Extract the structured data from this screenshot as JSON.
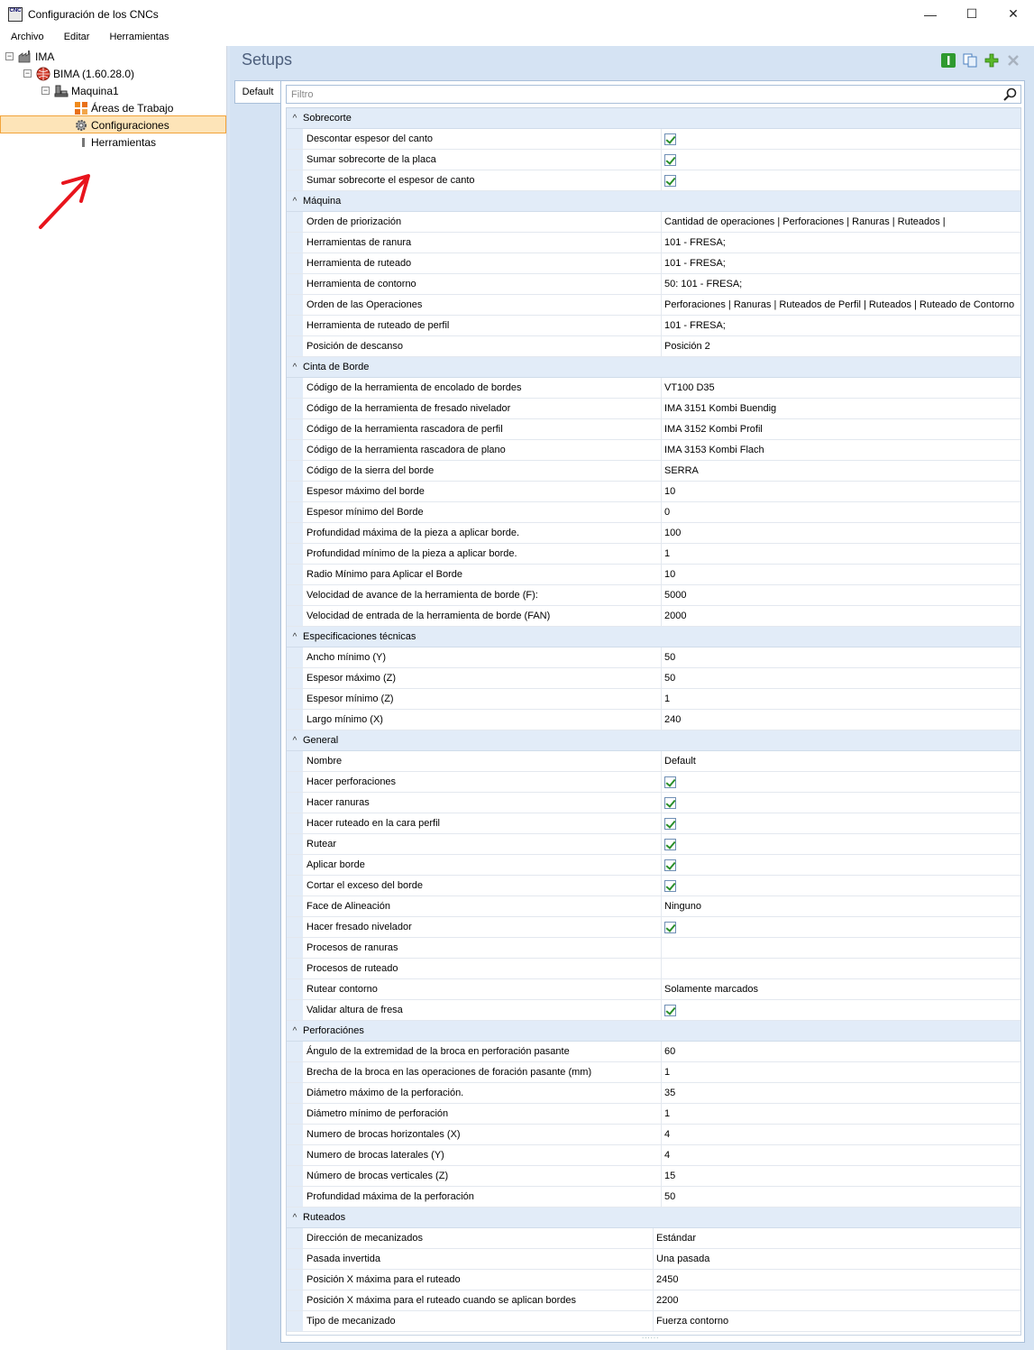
{
  "window": {
    "title": "Configuración de los CNCs",
    "icon_text": "CNC",
    "controls": [
      "—",
      "☐",
      "✕"
    ]
  },
  "menu": [
    "Archivo",
    "Editar",
    "Herramientas"
  ],
  "tree": [
    {
      "label": "IMA",
      "level": 0,
      "expander": "−",
      "icon": "factory-icon"
    },
    {
      "label": "BIMA (1.60.28.0)",
      "level": 1,
      "expander": "−",
      "icon": "globe-icon"
    },
    {
      "label": "Maquina1",
      "level": 2,
      "expander": "−",
      "icon": "machine-icon"
    },
    {
      "label": "Áreas de Trabajo",
      "level": 3,
      "icon": "grid-icon"
    },
    {
      "label": "Configuraciones",
      "level": 3,
      "icon": "gear-icon",
      "selected": true
    },
    {
      "label": "Herramientas",
      "level": 3,
      "icon": "tools-icon"
    }
  ],
  "panel": {
    "title": "Setups",
    "tab": "Default",
    "filter_placeholder": "Filtro"
  },
  "categories": [
    {
      "name": "Sobrecorte",
      "rows": [
        {
          "name": "Descontar espesor del canto",
          "check": true
        },
        {
          "name": "Sumar sobrecorte de la placa",
          "check": true
        },
        {
          "name": "Sumar sobrecorte el espesor de canto",
          "check": true
        }
      ]
    },
    {
      "name": "Máquina",
      "rows": [
        {
          "name": "Orden de priorización",
          "value": "Cantidad de operaciones | Perforaciones | Ranuras | Ruteados |"
        },
        {
          "name": "Herramientas de ranura",
          "value": "101 - FRESA;"
        },
        {
          "name": "Herramienta de ruteado",
          "value": "101 - FRESA;"
        },
        {
          "name": "Herramienta de contorno",
          "value": "50: 101 - FRESA;"
        },
        {
          "name": "Orden de las Operaciones",
          "value": "Perforaciones | Ranuras | Ruteados de Perfil | Ruteados | Ruteado de Contorno"
        },
        {
          "name": "Herramienta de ruteado de perfil",
          "value": "101 - FRESA;"
        },
        {
          "name": "Posición de descanso",
          "value": "Posición 2"
        }
      ]
    },
    {
      "name": "Cinta de Borde",
      "rows": [
        {
          "name": "Código de la herramienta de encolado de bordes",
          "value": "VT100 D35"
        },
        {
          "name": "Código de la herramienta de fresado nivelador",
          "value": "IMA 3151 Kombi Buendig"
        },
        {
          "name": "Código de la herramienta rascadora de perfil",
          "value": "IMA 3152 Kombi Profil"
        },
        {
          "name": "Código de la herramienta rascadora de plano",
          "value": "IMA 3153 Kombi Flach"
        },
        {
          "name": "Código de la sierra del borde",
          "value": "SERRA"
        },
        {
          "name": "Espesor máximo del borde",
          "value": "10"
        },
        {
          "name": "Espesor mínimo del Borde",
          "value": "0"
        },
        {
          "name": "Profundidad máxima de la pieza a aplicar borde.",
          "value": "100"
        },
        {
          "name": "Profundidad mínimo de la pieza a aplicar borde.",
          "value": "1"
        },
        {
          "name": "Radio Mínimo para Aplicar el Borde",
          "value": "10"
        },
        {
          "name": "Velocidad de avance de la herramienta de borde (F):",
          "value": "5000"
        },
        {
          "name": "Velocidad de entrada de la herramienta de borde (FAN)",
          "value": "2000"
        }
      ]
    },
    {
      "name": "Especificaciones técnicas",
      "rows": [
        {
          "name": "Ancho mínimo (Y)",
          "value": "50"
        },
        {
          "name": "Espesor máximo (Z)",
          "value": "50"
        },
        {
          "name": "Espesor mínimo (Z)",
          "value": "1"
        },
        {
          "name": "Largo mínimo (X)",
          "value": "240"
        }
      ]
    },
    {
      "name": "General",
      "rows": [
        {
          "name": "Nombre",
          "value": "Default"
        },
        {
          "name": "Hacer perforaciones",
          "check": true
        },
        {
          "name": "Hacer ranuras",
          "check": true
        },
        {
          "name": "Hacer ruteado en la cara perfil",
          "check": true
        },
        {
          "name": "Rutear",
          "check": true
        },
        {
          "name": "Aplicar borde",
          "check": true
        },
        {
          "name": "Cortar el exceso del borde",
          "check": true
        },
        {
          "name": "Face de Alineación",
          "value": "Ninguno"
        },
        {
          "name": "Hacer fresado nivelador",
          "check": true
        },
        {
          "name": "Procesos de ranuras",
          "value": ""
        },
        {
          "name": "Procesos de ruteado",
          "value": ""
        },
        {
          "name": "Rutear contorno",
          "value": "Solamente marcados"
        },
        {
          "name": "Validar altura de fresa",
          "check": true
        }
      ]
    },
    {
      "name": "Perforaciónes",
      "rows": [
        {
          "name": "Ángulo de la extremidad de la broca en perforación pasante",
          "value": "60"
        },
        {
          "name": "Brecha de la broca en las operaciones de foración pasante (mm)",
          "value": "1"
        },
        {
          "name": "Diámetro máximo de la perforación.",
          "value": "35"
        },
        {
          "name": "Diámetro mínimo de perforación",
          "value": "1"
        },
        {
          "name": "Numero de brocas horizontales (X)",
          "value": "4"
        },
        {
          "name": "Numero de brocas laterales (Y)",
          "value": "4"
        },
        {
          "name": "Número de brocas verticales (Z)",
          "value": "15"
        },
        {
          "name": "Profundidad máxima de la perforación",
          "value": "50"
        }
      ]
    },
    {
      "name": "Ruteados",
      "narrow": true,
      "rows": [
        {
          "name": "Dirección de mecanizados",
          "value": "Estándar"
        },
        {
          "name": "Pasada invertida",
          "value": "Una pasada"
        },
        {
          "name": "Posición X máxima para el ruteado",
          "value": "2450"
        },
        {
          "name": "Posición X máxima para el ruteado cuando se aplican bordes",
          "value": "2200"
        },
        {
          "name": "Tipo de mecanizado",
          "value": "Fuerza contorno"
        }
      ]
    }
  ]
}
